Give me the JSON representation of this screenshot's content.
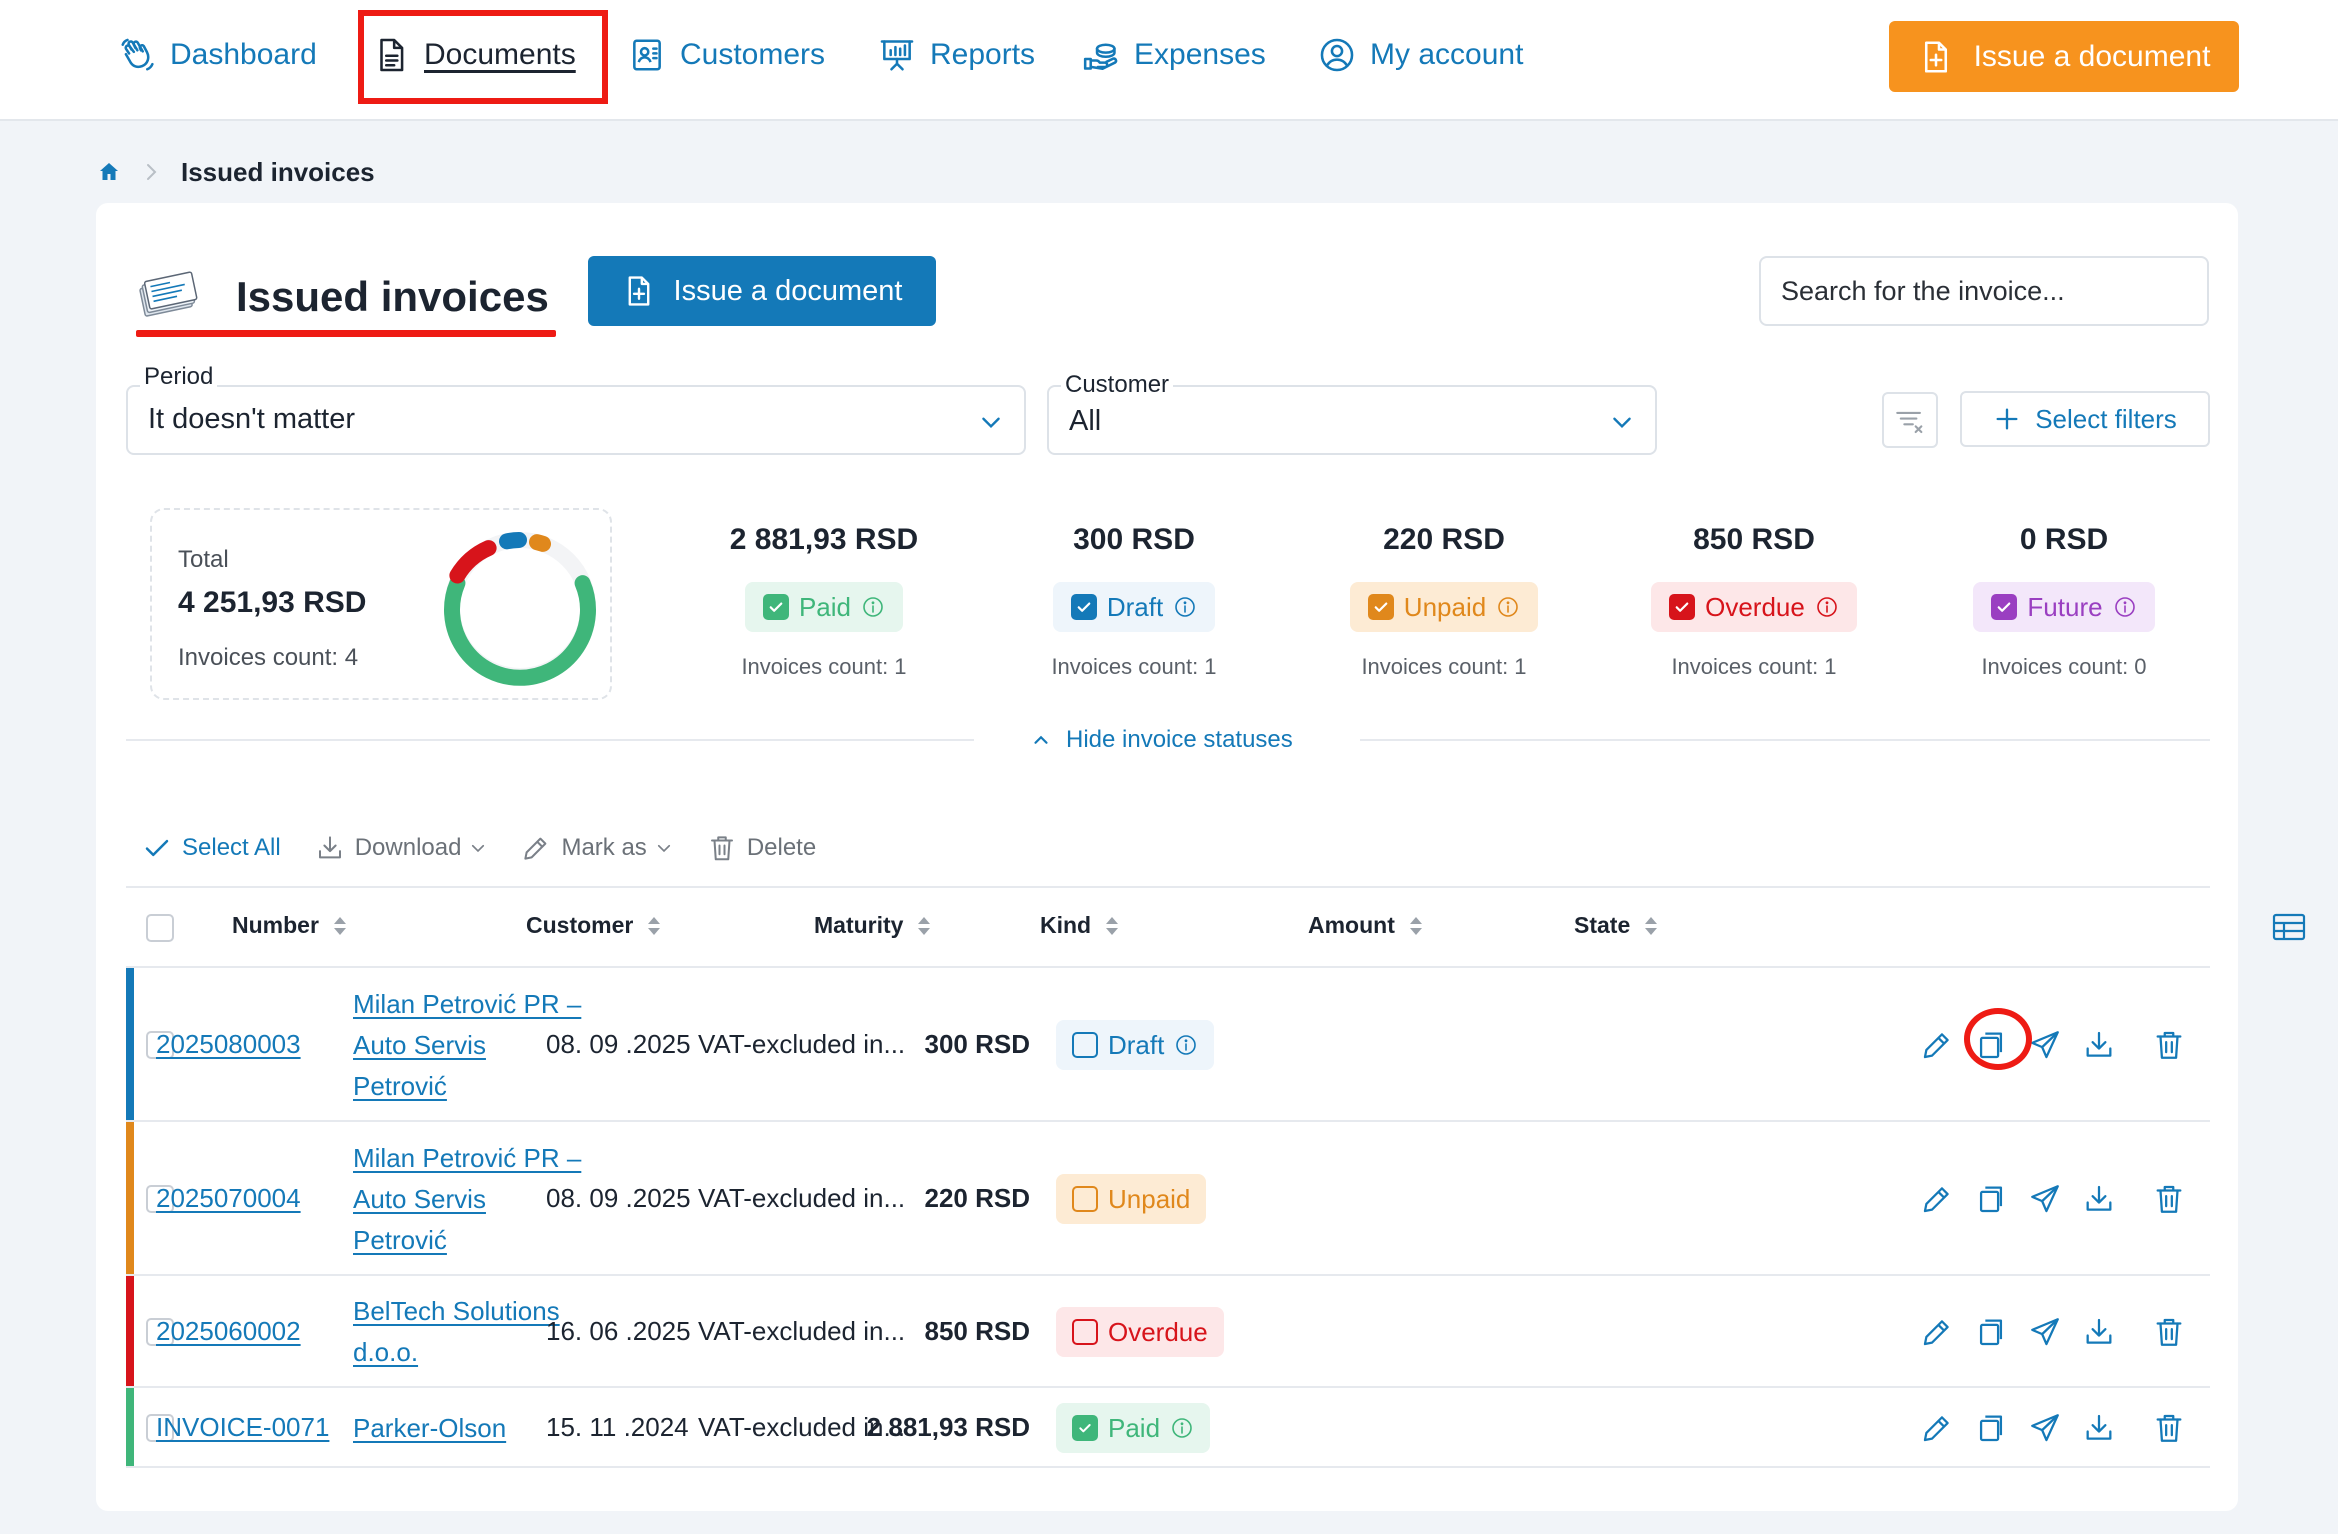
{
  "nav": {
    "items": [
      {
        "label": "Dashboard",
        "icon": "hand-wave-icon"
      },
      {
        "label": "Documents",
        "icon": "document-icon",
        "active": true
      },
      {
        "label": "Customers",
        "icon": "contacts-icon"
      },
      {
        "label": "Reports",
        "icon": "presentation-chart-icon"
      },
      {
        "label": "Expenses",
        "icon": "hand-money-icon"
      },
      {
        "label": "My account",
        "icon": "user-circle-icon"
      }
    ],
    "issue_button": "Issue a document"
  },
  "breadcrumb": {
    "current": "Issued invoices"
  },
  "header": {
    "title": "Issued invoices",
    "issue_button": "Issue a document",
    "search_placeholder": "Search for the invoice..."
  },
  "filters": {
    "period": {
      "label": "Period",
      "value": "It doesn't matter"
    },
    "customer": {
      "label": "Customer",
      "value": "All"
    },
    "select_filters": "Select filters"
  },
  "summary": {
    "total_label": "Total",
    "total_value": "4 251,93 RSD",
    "total_count": "Invoices count: 4",
    "statuses": [
      {
        "amount": "2 881,93 RSD",
        "label": "Paid",
        "count": "Invoices count: 1",
        "color": "#3fb67a",
        "bg": "#e6f6ee",
        "text": "#3fb67a"
      },
      {
        "amount": "300 RSD",
        "label": "Draft",
        "count": "Invoices count: 1",
        "color": "#1479b8",
        "bg": "#eef5fb",
        "text": "#1479b8"
      },
      {
        "amount": "220 RSD",
        "label": "Unpaid",
        "count": "Invoices count: 1",
        "color": "#e0881c",
        "bg": "#fdebd4",
        "text": "#e0881c"
      },
      {
        "amount": "850 RSD",
        "label": "Overdue",
        "count": "Invoices count: 1",
        "color": "#d7141b",
        "bg": "#fde7e8",
        "text": "#d7141b"
      },
      {
        "amount": "0 RSD",
        "label": "Future",
        "count": "Invoices count: 0",
        "color": "#9a3fc1",
        "bg": "#f3e7fa",
        "text": "#9a3fc1"
      }
    ],
    "hide_statuses": "Hide invoice statuses"
  },
  "toolbar": {
    "select_all": "Select All",
    "download": "Download",
    "mark_as": "Mark as",
    "delete": "Delete"
  },
  "table": {
    "columns": [
      "Number",
      "Customer",
      "Maturity",
      "Kind",
      "Amount",
      "State"
    ],
    "rows": [
      {
        "number": "2025080003",
        "customer": [
          "Milan Petrović PR –",
          "Auto Servis",
          "Petrović"
        ],
        "maturity": "08. 09 .2025",
        "kind": "VAT-excluded in...",
        "amount": "300 RSD",
        "state": "Draft",
        "stripe": "#1479b8"
      },
      {
        "number": "2025070004",
        "customer": [
          "Milan Petrović PR –",
          "Auto Servis",
          "Petrović"
        ],
        "maturity": "08. 09 .2025",
        "kind": "VAT-excluded in...",
        "amount": "220 RSD",
        "state": "Unpaid",
        "stripe": "#e0881c"
      },
      {
        "number": "2025060002",
        "customer": [
          "BelTech Solutions",
          "d.o.o."
        ],
        "maturity": "16. 06 .2025",
        "kind": "VAT-excluded in...",
        "amount": "850 RSD",
        "state": "Overdue",
        "stripe": "#d7141b"
      },
      {
        "number": "INVOICE-0071",
        "customer": [
          "Parker-Olson"
        ],
        "maturity": "15. 11 .2024",
        "kind": "VAT-excluded in...",
        "amount": "2 881,93 RSD",
        "state": "Paid",
        "stripe": "#3fb67a"
      }
    ]
  },
  "colors": {
    "accent": "#1479b8",
    "orange": "#f7931e",
    "annotation": "#ee1b14"
  }
}
